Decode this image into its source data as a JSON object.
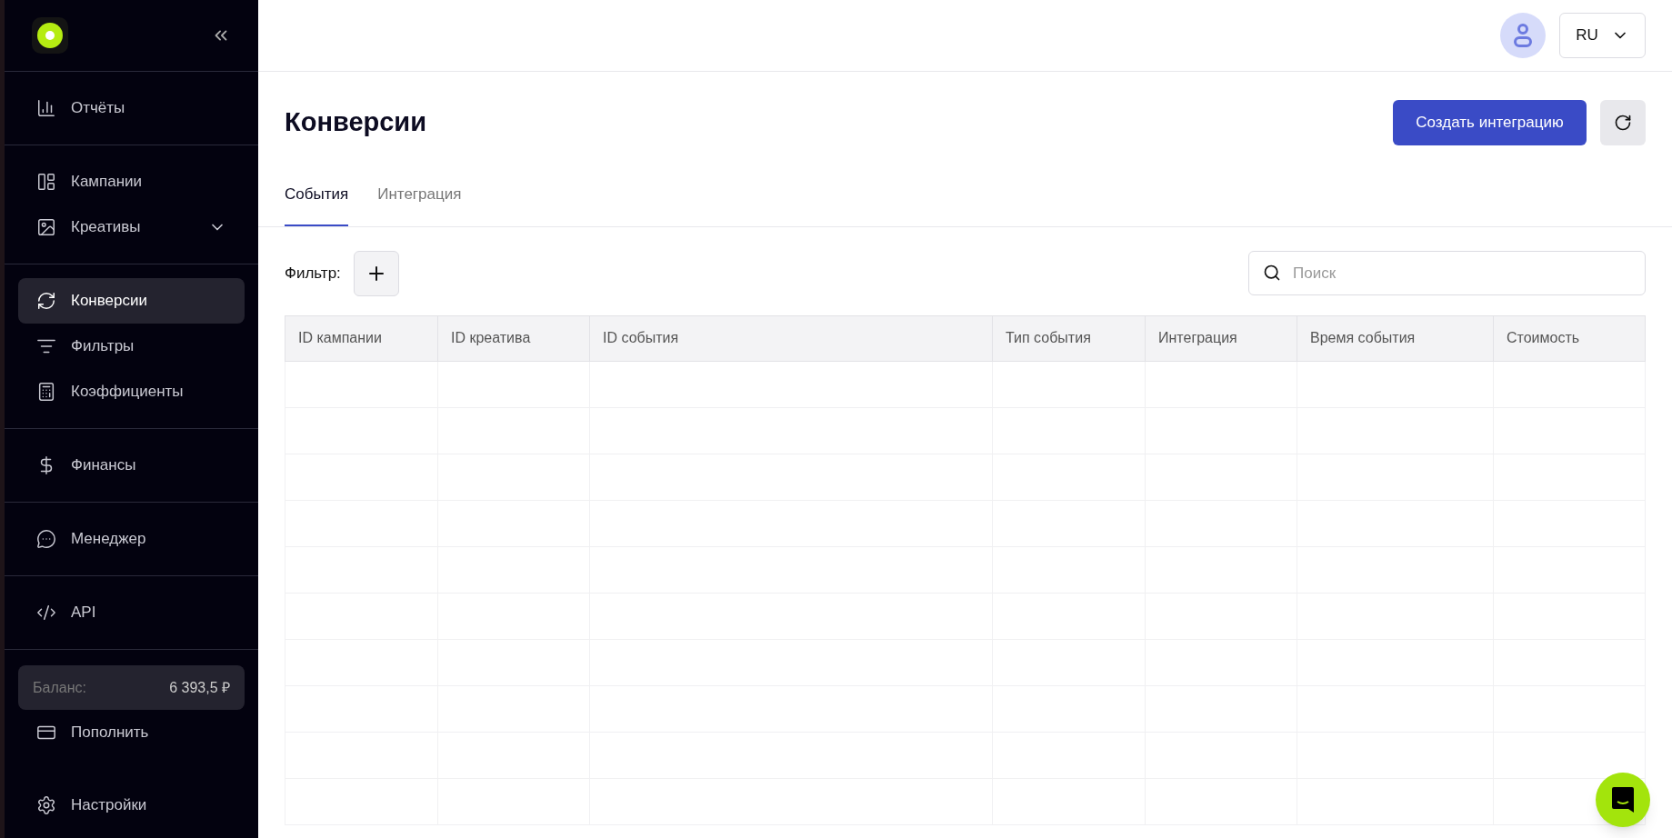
{
  "sidebar": {
    "sections": [
      {
        "items": [
          {
            "label": "Отчёты",
            "selected": false
          }
        ]
      },
      {
        "items": [
          {
            "label": "Кампании",
            "selected": false
          },
          {
            "label": "Креативы",
            "selected": false,
            "expanded": false
          }
        ]
      },
      {
        "items": [
          {
            "label": "Конверсии",
            "selected": true
          },
          {
            "label": "Фильтры",
            "selected": false
          },
          {
            "label": "Коэффициенты",
            "selected": false
          }
        ]
      },
      {
        "items": [
          {
            "label": "Финансы",
            "selected": false
          }
        ]
      },
      {
        "items": [
          {
            "label": "Менеджер",
            "selected": false
          }
        ]
      },
      {
        "items": [
          {
            "label": "API",
            "selected": false
          }
        ]
      }
    ],
    "balance": {
      "label": "Баланс:",
      "value": "6 393,5 ₽"
    },
    "topup": {
      "label": "Пополнить"
    },
    "settings": {
      "label": "Настройки"
    }
  },
  "header": {
    "language": "RU"
  },
  "page": {
    "title": "Конверсии",
    "create_button": "Создать интеграцию"
  },
  "tabs": [
    {
      "label": "События",
      "selected": true
    },
    {
      "label": "Интеграция",
      "selected": false
    }
  ],
  "filter": {
    "label": "Фильтр:"
  },
  "search": {
    "placeholder": "Поиск"
  },
  "table": {
    "columns": [
      "ID кампании",
      "ID креатива",
      "ID события",
      "Тип события",
      "Интеграция",
      "Время события",
      "Стоимость"
    ]
  }
}
